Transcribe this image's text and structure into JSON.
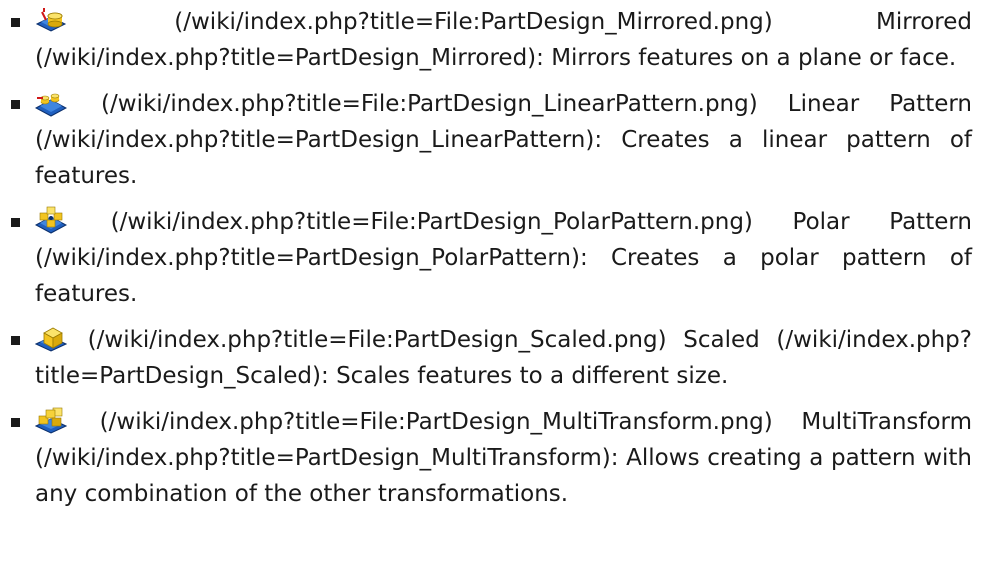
{
  "items": [
    {
      "icon": "mirrored-icon",
      "image_link": "(/wiki/index.php?title=File:PartDesign_Mirrored.png)",
      "name": "Mirrored",
      "page_link": "(/wiki/index.php?title=PartDesign_Mirrored)",
      "description": ": Mirrors features on a plane or face."
    },
    {
      "icon": "linear-pattern-icon",
      "image_link": "(/wiki/index.php?title=File:PartDesign_LinearPattern.png)",
      "name": "Linear Pattern",
      "page_link": "(/wiki/index.php?title=PartDesign_LinearPattern)",
      "description": ": Creates a linear pattern of features."
    },
    {
      "icon": "polar-pattern-icon",
      "image_link": "(/wiki/index.php?title=File:PartDesign_PolarPattern.png)",
      "name": "Polar Pattern",
      "page_link": "(/wiki/index.php?title=PartDesign_PolarPattern)",
      "description": ": Creates a polar pattern of features."
    },
    {
      "icon": "scaled-icon",
      "image_link": "(/wiki/index.php?title=File:PartDesign_Scaled.png)",
      "name": "Scaled",
      "page_link": "(/wiki/index.php?title=PartDesign_Scaled)",
      "description": ": Scales features to a different size."
    },
    {
      "icon": "multitransform-icon",
      "image_link": "(/wiki/index.php?title=File:PartDesign_MultiTransform.png)",
      "name": "MultiTransform",
      "page_link": "(/wiki/index.php?title=PartDesign_MultiTransform)",
      "description": ": Allows creating a pattern with any combination of the other transformations."
    }
  ]
}
